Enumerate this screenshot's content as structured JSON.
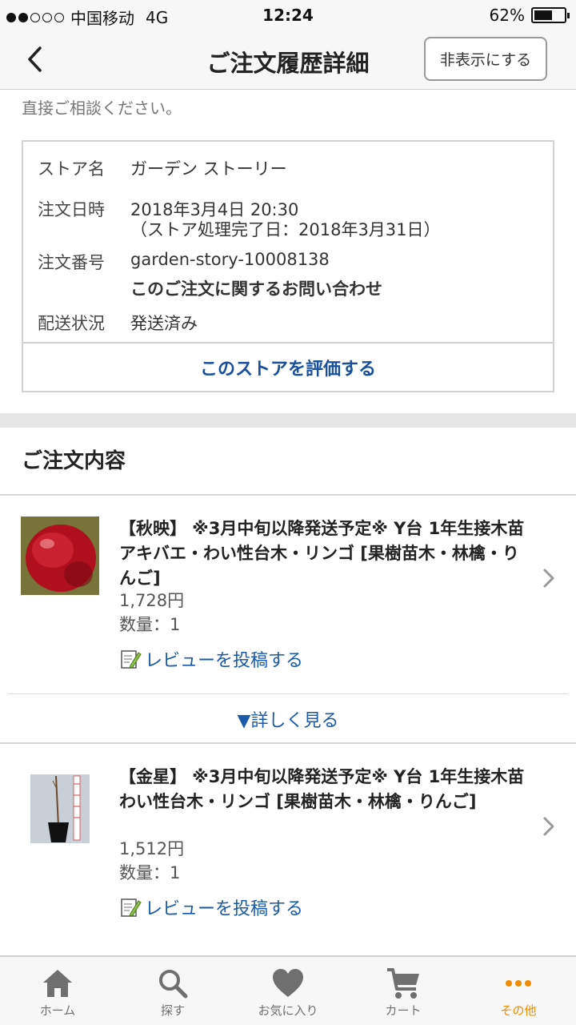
{
  "status_bar": {
    "carrier": "中国移动",
    "network": "4G",
    "time": "12:24",
    "battery_text": "62%",
    "battery_level": 0.62
  },
  "nav": {
    "title": "ご注文履歴詳細",
    "hide_button": "非表示にする"
  },
  "note_text": "直接ご相談ください。",
  "order_info": {
    "store_label": "ストア名",
    "store_name": "ガーデン ストーリー",
    "date_label": "注文日時",
    "date_value": "2018年3月4日 20:30",
    "completed_value": "（ストア処理完了日：2018年3月31日）",
    "number_label": "注文番号",
    "number_value": "garden-story-10008138",
    "contact_link": "このご注文に関するお問い合わせ",
    "status_label": "配送状況",
    "status_value": "発送済み",
    "rate_button": "このストアを評価する"
  },
  "section_title": "ご注文内容",
  "products": [
    {
      "title": "【秋映】 ※3月中旬以降発送予定※ Y台 1年生接木苗 アキバエ・わい性台木・リンゴ [果樹苗木・林檎・りんご]",
      "price": "1,728円",
      "quantity": "数量：1",
      "review": "レビューを投稿する"
    },
    {
      "title": "【金星】 ※3月中旬以降発送予定※ Y台 1年生接木苗 わい性台木・リンゴ [果樹苗木・林檎・りんご]",
      "price": "1,512円",
      "quantity": "数量：1",
      "review": "レビューを投稿する"
    }
  ],
  "more_link": "▼詳しく見る",
  "tabs": [
    {
      "label": "ホーム",
      "icon": "home-icon"
    },
    {
      "label": "探す",
      "icon": "search-icon"
    },
    {
      "label": "お気に入り",
      "icon": "heart-icon"
    },
    {
      "label": "カート",
      "icon": "cart-icon"
    },
    {
      "label": "その他",
      "icon": "more-icon",
      "active": true
    }
  ],
  "colors": {
    "link": "#1a5aa8",
    "active_tab": "#f08c00",
    "tab_icon": "#6f6f6f"
  }
}
